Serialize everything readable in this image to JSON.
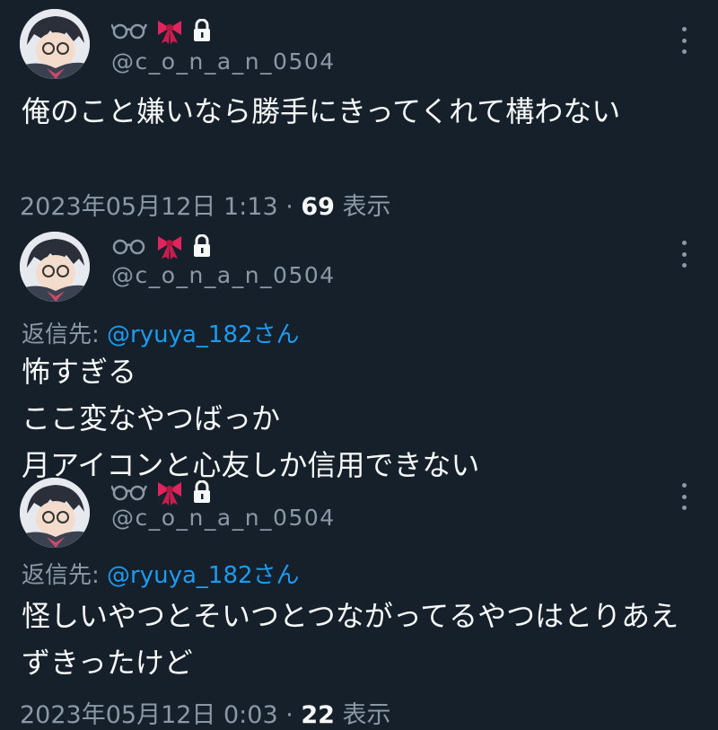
{
  "tweets": [
    {
      "handle": "@c_o_n_a_n_0504",
      "body": "俺のこと嫌いなら勝手にきってくれて構わない",
      "reply_prefix": "",
      "reply_handle": "",
      "reply_suffix": "",
      "date": "2023年05月12日 1:13 · ",
      "views": "69",
      "views_label": " 表示"
    },
    {
      "handle": "@c_o_n_a_n_0504",
      "reply_prefix": "返信先: ",
      "reply_handle": "@ryuya_182",
      "reply_suffix": "さん",
      "body": "怖すぎる\nここ変なやつばっか\n月アイコンと心友しか信用できない"
    },
    {
      "handle": "@c_o_n_a_n_0504",
      "reply_prefix": "返信先: ",
      "reply_handle": "@ryuya_182",
      "reply_suffix": "さん",
      "body": "怪しいやつとそいつとつながってるやつはとりあえずきったけど",
      "date": "2023年05月12日 0:03 · ",
      "views": "22",
      "views_label": " 表示"
    }
  ],
  "colors": {
    "background": "#15202b",
    "text": "#f7f9f9",
    "secondary": "#8b98a5",
    "link": "#1d9bf0",
    "ribbon": "#e0245e"
  },
  "icons": [
    "avatar",
    "glasses-icon",
    "ribbon-icon",
    "lock-icon",
    "more-options-icon"
  ]
}
